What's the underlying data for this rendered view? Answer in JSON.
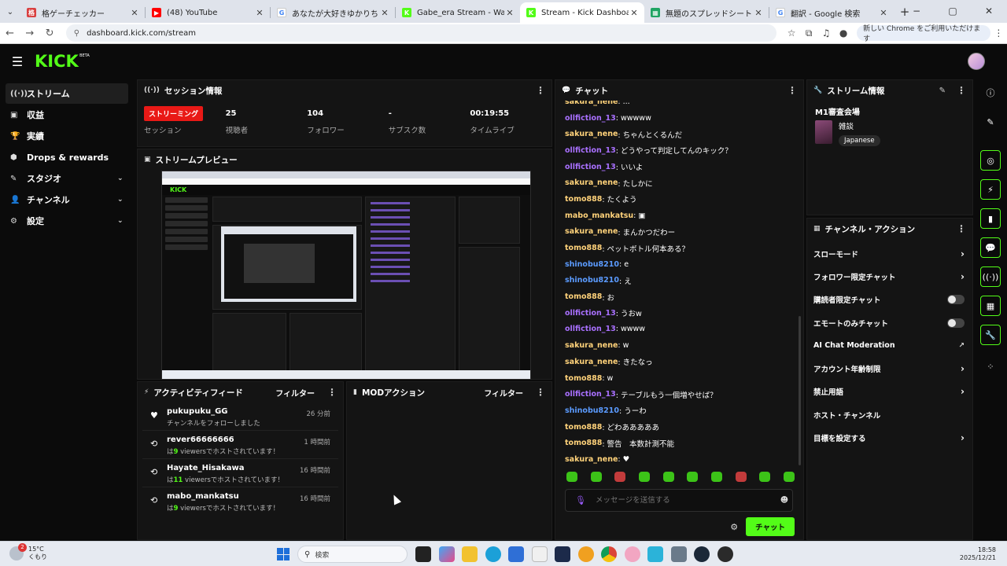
{
  "browser": {
    "tabs": [
      {
        "title": "格ゲーチェッカー",
        "fav_color": "#d94040",
        "fav_glyph": "格"
      },
      {
        "title": "(48) YouTube",
        "fav_color": "#ff0000",
        "fav_glyph": "▶"
      },
      {
        "title": "あなたが大好きゆかりちゃんー(ふん...",
        "fav_color": "#ffffff",
        "fav_glyph": "G"
      },
      {
        "title": "Gabe_era Stream - Watch Live...",
        "fav_color": "#53fc18",
        "fav_glyph": "K"
      },
      {
        "title": "Stream - Kick Dashboard",
        "fav_color": "#53fc18",
        "fav_glyph": "K"
      },
      {
        "title": "無題のスプレッドシート - Google ス...",
        "fav_color": "#1fa463",
        "fav_glyph": "▦"
      },
      {
        "title": "翻訳 - Google 検索",
        "fav_color": "#ffffff",
        "fav_glyph": "G"
      }
    ],
    "active_tab": 4,
    "url": "dashboard.kick.com/stream",
    "chrome_notice": "新しい Chrome をご利用いただけます"
  },
  "header": {
    "logo": "KICK",
    "logo_badge": "BETA"
  },
  "sidebar": {
    "items": [
      {
        "label": "ストリーム",
        "icon": "((·))",
        "active": true,
        "chevron": false
      },
      {
        "label": "収益",
        "icon": "▣",
        "active": false,
        "chevron": false
      },
      {
        "label": "実績",
        "icon": "🏆",
        "active": false,
        "chevron": false
      },
      {
        "label": "Drops & rewards",
        "icon": "⬢",
        "active": false,
        "chevron": false
      },
      {
        "label": "スタジオ",
        "icon": "✎",
        "active": false,
        "chevron": true
      },
      {
        "label": "チャンネル",
        "icon": "👤",
        "active": false,
        "chevron": true
      },
      {
        "label": "設定",
        "icon": "⚙",
        "active": false,
        "chevron": true
      }
    ]
  },
  "session": {
    "title": "セッション情報",
    "live_label": "ストリーミング",
    "session_label": "セッション",
    "stats": [
      {
        "value": "25",
        "label": "視聴者"
      },
      {
        "value": "104",
        "label": "フォロワー"
      },
      {
        "value": "-",
        "label": "サブスク数"
      },
      {
        "value": "00:19:55",
        "label": "タイムライブ"
      }
    ]
  },
  "preview": {
    "title": "ストリームプレビュー"
  },
  "activity": {
    "title": "アクティビティフィード",
    "filter": "フィルター",
    "items": [
      {
        "user": "pukupuku_GG",
        "desc": "チャンネルをフォローしました",
        "num": "",
        "time": "26 分前",
        "icon": "♥"
      },
      {
        "user": "rever66666666",
        "desc_prefix": "は",
        "num": "9",
        "desc": " viewersでホストされています！",
        "time": "1 時間前",
        "icon": "⟲"
      },
      {
        "user": "Hayate_Hisakawa",
        "desc_prefix": "は",
        "num": "11",
        "desc": " viewersでホストされています！",
        "time": "16 時間前",
        "icon": "⟲"
      },
      {
        "user": "mabo_mankatsu",
        "desc_prefix": "は",
        "num": "9",
        "desc": " viewersでホストされています！",
        "time": "16 時間前",
        "icon": "⟲"
      }
    ]
  },
  "mod": {
    "title": "MODアクション",
    "filter": "フィルター"
  },
  "chat": {
    "title": "チャット",
    "messages": [
      {
        "user": "sakura_nene",
        "text": ": ...",
        "color": "#ffd27a"
      },
      {
        "user": "ollfiction_13",
        "text": ": wwwww",
        "color": "#a970ff"
      },
      {
        "user": "sakura_nene",
        "text": ": ちゃんとくるんだ",
        "color": "#ffd27a"
      },
      {
        "user": "ollfiction_13",
        "text": ": どうやって判定してんのキック？",
        "color": "#a970ff"
      },
      {
        "user": "ollfiction_13",
        "text": ": いいよ",
        "color": "#a970ff"
      },
      {
        "user": "sakura_nene",
        "text": ": たしかに",
        "color": "#ffd27a"
      },
      {
        "user": "tomo888",
        "text": ": たくよう",
        "color": "#ffd27a"
      },
      {
        "user": "mabo_mankatsu",
        "text": ":  ▣",
        "color": "#ffd27a"
      },
      {
        "user": "sakura_nene",
        "text": ": まんかつだわー",
        "color": "#ffd27a"
      },
      {
        "user": "tomo888",
        "text": ": ペットボトル何本ある？",
        "color": "#ffd27a"
      },
      {
        "user": "shinobu8210",
        "text": ": e",
        "color": "#5b9bff"
      },
      {
        "user": "shinobu8210",
        "text": ": え",
        "color": "#5b9bff"
      },
      {
        "user": "tomo888",
        "text": ": お",
        "color": "#ffd27a"
      },
      {
        "user": "ollfiction_13",
        "text": ": うおw",
        "color": "#a970ff"
      },
      {
        "user": "ollfiction_13",
        "text": ": wwww",
        "color": "#a970ff"
      },
      {
        "user": "sakura_nene",
        "text": ": w",
        "color": "#ffd27a"
      },
      {
        "user": "sakura_nene",
        "text": ": きたなっ",
        "color": "#ffd27a"
      },
      {
        "user": "tomo888",
        "text": ": w",
        "color": "#ffd27a"
      },
      {
        "user": "ollfiction_13",
        "text": ": テーブルもう一個増やせば？",
        "color": "#a970ff"
      },
      {
        "user": "shinobu8210",
        "text": ": うーわ",
        "color": "#5b9bff"
      },
      {
        "user": "tomo888",
        "text": ": どわあああああ",
        "color": "#ffd27a"
      },
      {
        "user": "tomo888",
        "text": ": 警告　本数計測不能",
        "color": "#ffd27a"
      },
      {
        "user": "sakura_nene",
        "text": ": ♥",
        "color": "#ffd27a"
      }
    ],
    "placeholder": "メッセージを送信する",
    "send_label": "チャット",
    "emote_count": 10
  },
  "stream_info": {
    "title": "ストリーム情報",
    "stream_title": "M1審査会場",
    "category": "雑談",
    "language": "Japanese"
  },
  "channel_actions": {
    "title": "チャンネル・アクション",
    "items": [
      {
        "label": "スローモード",
        "control": "arrow"
      },
      {
        "label": "フォロワー限定チャット",
        "control": "arrow"
      },
      {
        "label": "購読者限定チャット",
        "control": "toggle"
      },
      {
        "label": "エモートのみチャット",
        "control": "toggle"
      },
      {
        "label": "AI Chat Moderation",
        "control": "external"
      },
      {
        "label": "アカウント年齢制限",
        "control": "arrow"
      },
      {
        "label": "禁止用語",
        "control": "arrow"
      },
      {
        "label": "ホスト・チャンネル",
        "control": "none"
      },
      {
        "label": "目標を設定する",
        "control": "arrow"
      }
    ]
  },
  "taskbar": {
    "temp": "15°C",
    "weather": "くもり",
    "badge": "2",
    "search": "検索",
    "time": "18:58",
    "date": "2025/12/21"
  }
}
